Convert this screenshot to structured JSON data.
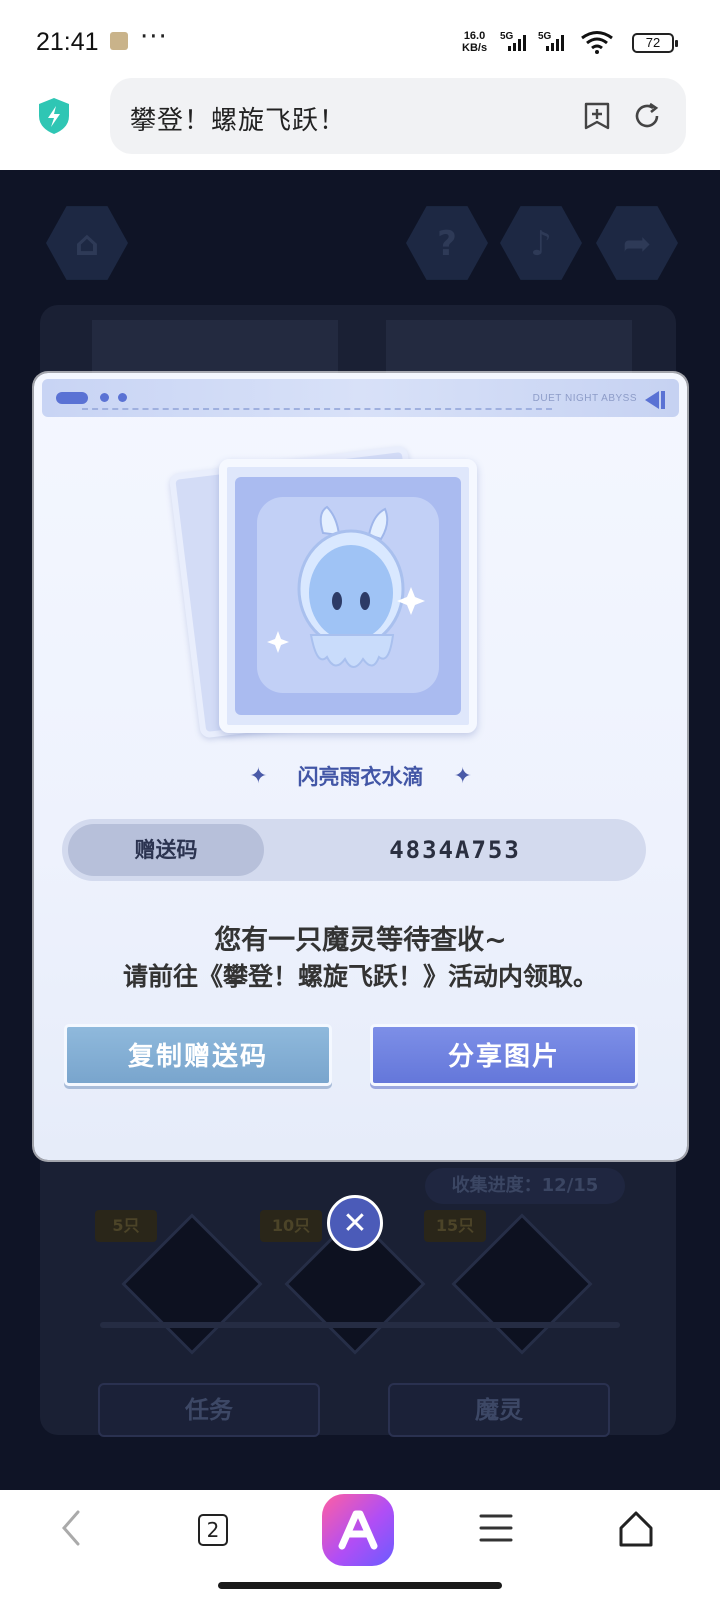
{
  "status_bar": {
    "time": "21:41",
    "more": "···",
    "net_speed_value": "16.0",
    "net_speed_unit": "KB/s",
    "sim1": "5G",
    "sim2": "5G",
    "battery": "72"
  },
  "address_bar": {
    "title": "攀登！螺旋飞跃！"
  },
  "game": {
    "collect_progress": "收集进度：12/15",
    "milestones": [
      "5只",
      "10只",
      "15只"
    ],
    "task_button": "任务",
    "sprite_button": "魔灵"
  },
  "modal": {
    "brand": "DUET NIGHT ABYSS",
    "sprite_name": "闪亮雨衣水滴",
    "code_label": "赠送码",
    "code_value": "4834A753",
    "message_line1": "您有一只魔灵等待查收~",
    "message_line2": "请前往《攀登！螺旋飞跃！》活动内领取。",
    "copy_button": "复制赠送码",
    "share_button": "分享图片"
  },
  "close_icon": "close-icon",
  "bottom_nav": {
    "tab_count": "2"
  },
  "colors": {
    "accent": "#6477da",
    "modal_bg": "#eef2fd",
    "game_bg": "#0f1426"
  }
}
